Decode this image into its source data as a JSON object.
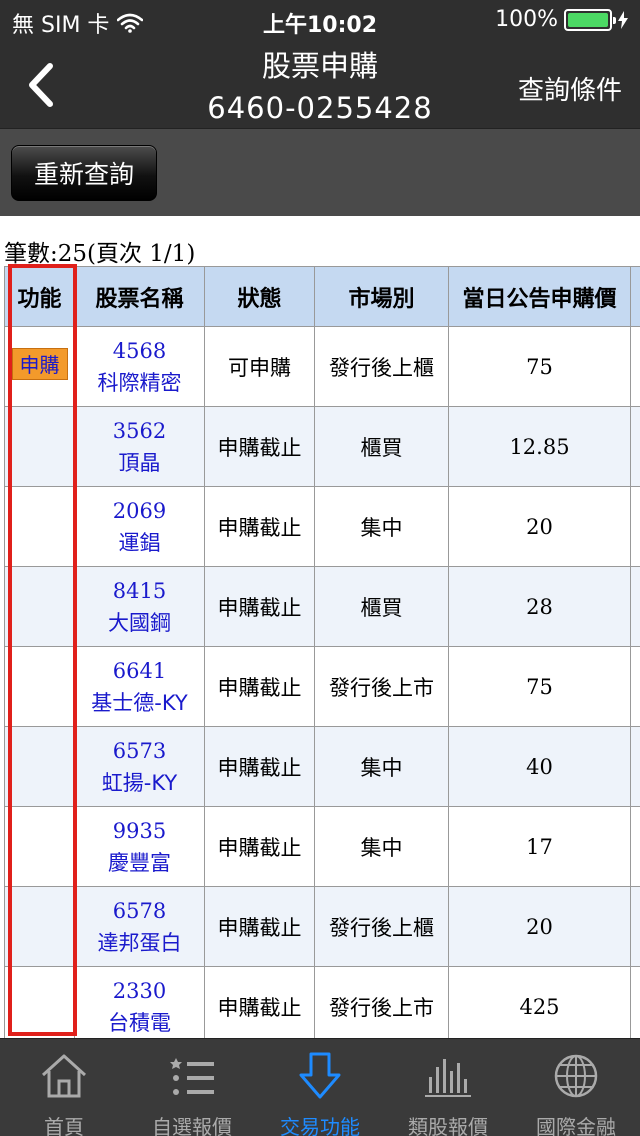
{
  "status_bar": {
    "carrier": "無 SIM 卡",
    "time": "上午10:02",
    "battery": "100%",
    "battery_level": 1.0
  },
  "nav": {
    "title": "股票申購",
    "account": "6460-0255428",
    "right_button": "查詢條件"
  },
  "toolbar": {
    "requery_label": "重新查詢"
  },
  "summary": {
    "text": "筆數:25(頁次 1/1)"
  },
  "table": {
    "headers": [
      "功能",
      "股票名稱",
      "狀態",
      "市場別",
      "當日公告申購價"
    ],
    "rows": [
      {
        "action": "申購",
        "code": "4568",
        "name": "科際精密",
        "status": "可申購",
        "market": "發行後上櫃",
        "price": "75"
      },
      {
        "action": "",
        "code": "3562",
        "name": "頂晶",
        "status": "申購截止",
        "market": "櫃買",
        "price": "12.85"
      },
      {
        "action": "",
        "code": "2069",
        "name": "運錩",
        "status": "申購截止",
        "market": "集中",
        "price": "20"
      },
      {
        "action": "",
        "code": "8415",
        "name": "大國鋼",
        "status": "申購截止",
        "market": "櫃買",
        "price": "28"
      },
      {
        "action": "",
        "code": "6641",
        "name": "基士德-KY",
        "status": "申購截止",
        "market": "發行後上市",
        "price": "75"
      },
      {
        "action": "",
        "code": "6573",
        "name": "虹揚-KY",
        "status": "申購截止",
        "market": "集中",
        "price": "40"
      },
      {
        "action": "",
        "code": "9935",
        "name": "慶豐富",
        "status": "申購截止",
        "market": "集中",
        "price": "17"
      },
      {
        "action": "",
        "code": "6578",
        "name": "達邦蛋白",
        "status": "申購截止",
        "market": "發行後上櫃",
        "price": "20"
      },
      {
        "action": "",
        "code": "2330",
        "name": "台積電",
        "status": "申購截止",
        "market": "發行後上市",
        "price": "425"
      }
    ]
  },
  "tabbar": {
    "items": [
      {
        "label": "首頁",
        "icon": "home-icon"
      },
      {
        "label": "自選報價",
        "icon": "list-icon"
      },
      {
        "label": "交易功能",
        "icon": "download-arrow-icon",
        "active": true
      },
      {
        "label": "類股報價",
        "icon": "bar-chart-icon"
      },
      {
        "label": "國際金融",
        "icon": "globe-icon"
      }
    ]
  },
  "colors": {
    "header_bg": "#c5d9f1",
    "highlight": "#e0201b",
    "active_tab": "#1e8bff",
    "apply_button": "#f39a2b",
    "link_blue": "#1a1acc"
  }
}
